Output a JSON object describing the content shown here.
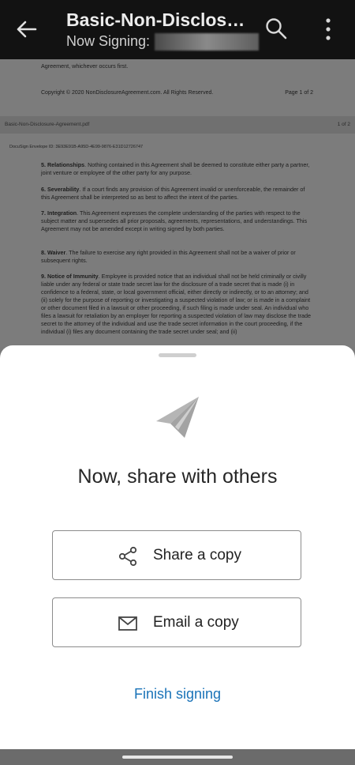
{
  "header": {
    "title": "Basic-Non-Disclosu...",
    "subtitle": "Now Signing:"
  },
  "document": {
    "top_fragment": "Agreement, whichever occurs first.",
    "copyright": "Copyright © 2020 NonDisclosureAgreement.com. All Rights Reserved.",
    "page_label": "Page 1 of 2",
    "file_name": "Basic-Non-Disclosure-Agreement.pdf",
    "page_count": "1 of 2",
    "envelope_id": "DocuSign Envelope ID: 3E93E91B-A95D-4E99-9876-E31D12726747",
    "sections": [
      {
        "head": "5. Relationships",
        "text": ". Nothing contained in this Agreement shall be deemed to constitute either party a partner, joint venture or employee of the other party for any purpose."
      },
      {
        "head": "6. Severability",
        "text": ". If a court finds any provision of this Agreement invalid or unenforceable, the remainder of this Agreement shall be interpreted so as best to affect the intent of the parties."
      },
      {
        "head": "7. Integration",
        "text": ". This Agreement expresses the complete understanding of the parties with respect to the subject matter and supersedes all prior proposals, agreements, representations, and understandings. This Agreement may not be amended except in writing signed by both parties."
      },
      {
        "head": "8. Waiver",
        "text": ". The failure to exercise any right provided in this Agreement shall not be a waiver of prior or subsequent rights."
      },
      {
        "head": "9. Notice of Immunity",
        "text": ". Employee is provided notice that an individual shall not be held criminally or civilly liable under any federal or state trade secret law for the disclosure of a trade secret that is made (i) in confidence to a federal, state, or local government official, either directly or indirectly, or to an attorney; and (ii) solely for the purpose of reporting or investigating a suspected violation of law; or is made in a complaint or other document filed in a lawsuit or other proceeding, if such filing is made under seal. An individual who files a lawsuit for retaliation by an employer for reporting a suspected violation of law may disclose the trade secret to the attorney of the individual and use the trade secret information in the court proceeding, if the individual (i) files any document containing the trade secret under seal; and (ii)"
      }
    ]
  },
  "sheet": {
    "heading": "Now, share with others",
    "share_label": "Share a copy",
    "email_label": "Email a copy",
    "finish_label": "Finish signing"
  },
  "icons": [
    "back-arrow-icon",
    "search-icon",
    "more-vert-icon",
    "paper-plane-icon",
    "share-icon",
    "envelope-icon"
  ],
  "colors": {
    "topbar": "#121212",
    "link": "#1a73b8",
    "icon_gray": "#b3b3b3"
  }
}
